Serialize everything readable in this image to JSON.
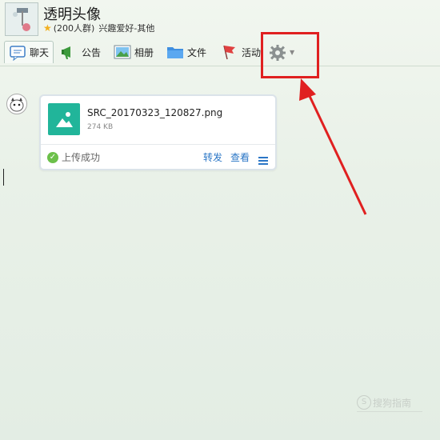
{
  "header": {
    "name": "透明头像",
    "member_count": "(200人群)",
    "category": "兴趣爱好-其他"
  },
  "toolbar": {
    "items": [
      {
        "label": "聊天",
        "icon": "chat-icon"
      },
      {
        "label": "公告",
        "icon": "announcement-icon"
      },
      {
        "label": "相册",
        "icon": "album-icon"
      },
      {
        "label": "文件",
        "icon": "folder-icon"
      },
      {
        "label": "活动",
        "icon": "flag-icon"
      }
    ],
    "settings_icon": "gear-icon"
  },
  "message": {
    "file_name": "SRC_20170323_120827.png",
    "file_size": "274 KB",
    "status": "上传成功",
    "forward": "转发",
    "view": "查看"
  },
  "watermark": {
    "logo": "S",
    "text": "搜狗指南"
  },
  "colors": {
    "highlight": "#e02020",
    "file_thumb": "#21b59a",
    "link": "#2a76c6",
    "success": "#6cc04a"
  }
}
